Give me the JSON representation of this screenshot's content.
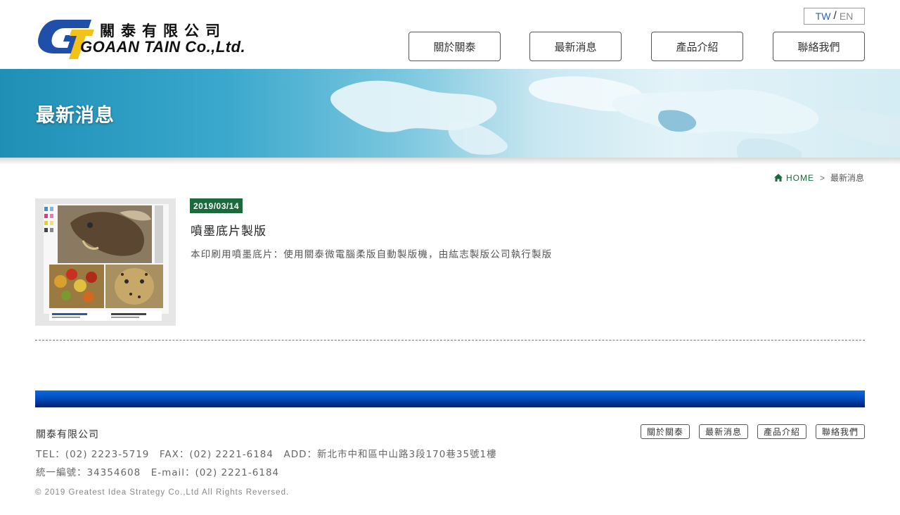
{
  "brand": {
    "name_cn": "關泰有限公司",
    "name_en": "GOAAN TAIN Co.,Ltd.",
    "logo_mark_letters": "GT"
  },
  "lang": {
    "tw": "TW",
    "separator": "/",
    "en": "EN"
  },
  "nav": [
    {
      "label": "關於關泰"
    },
    {
      "label": "最新消息"
    },
    {
      "label": "產品介紹"
    },
    {
      "label": "聯絡我們"
    }
  ],
  "banner": {
    "title": "最新消息"
  },
  "breadcrumb": {
    "home": "HOME",
    "arrow": ">",
    "current": "最新消息"
  },
  "article": {
    "date": "2019/03/14",
    "title": "噴墨底片製版",
    "description": "本印刷用噴墨底片：使用關泰微電腦柔版自動製版機，由紘志製版公司執行製版"
  },
  "footer": {
    "company": "關泰有限公司",
    "contact_line": "TEL：(02) 2223-5719　FAX：(02) 2221-6184　ADD：新北市中和區中山路3段170巷35號1樓",
    "id_line": "統一編號：34354608　E-mail：(02) 2221-6184",
    "copyright": "© 2019 Greatest Idea Strategy Co.,Ltd All Rights Reversed.",
    "nav": [
      {
        "label": "關於關泰"
      },
      {
        "label": "最新消息"
      },
      {
        "label": "產品介紹"
      },
      {
        "label": "聯絡我們"
      }
    ]
  },
  "colors": {
    "accent_green": "#1a6a3c",
    "lang_blue": "#2a64b8",
    "footer_bar": "#0a5ad0",
    "logo_blue": "#1f4fa8",
    "logo_yellow": "#f2c21b"
  }
}
